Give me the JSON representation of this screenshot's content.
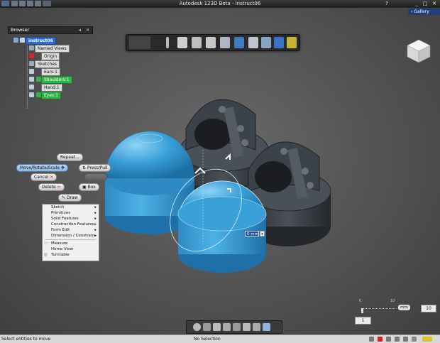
{
  "window": {
    "title": "Autodesk 123D Beta - instruct06",
    "gallery_label": "Gallery"
  },
  "browser": {
    "header": "Browser",
    "root": "instruct06",
    "items": [
      {
        "label": "Named Views",
        "style": "plain"
      },
      {
        "label": "Origin",
        "style": "plain"
      },
      {
        "label": "Sketches",
        "style": "plain"
      },
      {
        "label": "Ears:1",
        "style": "plain"
      },
      {
        "label": "Shoulders:1",
        "style": "green"
      },
      {
        "label": "Hand:1",
        "style": "plain"
      },
      {
        "label": "Eyes:1",
        "style": "green"
      }
    ]
  },
  "toolbar": {
    "icons": [
      "app-logo-icon",
      "info-icon",
      "box-icon",
      "cylinder-icon",
      "move-icon",
      "sketch-icon",
      "solid-icon",
      "shell-icon",
      "group-icon",
      "3d-text-icon",
      "material-icon"
    ]
  },
  "marking_menu": {
    "repeat": "Repeat...",
    "move": "Move/Rotate/Scale",
    "press_pull": "Press/Pull",
    "cancel": "Cancel",
    "delete": "Delete",
    "box": "Box",
    "draw": "Draw"
  },
  "context_menu": {
    "items": [
      {
        "label": "Sketch",
        "submenu": true
      },
      {
        "label": "Primitives",
        "submenu": true
      },
      {
        "label": "Solid Features",
        "submenu": true
      },
      {
        "label": "Construction Features",
        "submenu": true
      },
      {
        "label": "Form Edit",
        "submenu": true
      },
      {
        "label": "Dimension / Constrain",
        "submenu": true
      }
    ],
    "items2": [
      {
        "label": "Measure"
      },
      {
        "label": "Home View"
      },
      {
        "label": "Turntable"
      }
    ]
  },
  "dimension_input": {
    "value": "0 mm"
  },
  "grid_controls": {
    "ruler_start": "0",
    "ruler_end": "10",
    "unit": "mm",
    "grid_value": "10",
    "snap_value": "1"
  },
  "statusbar": {
    "hint": "Select entities to move",
    "selection": "No Selection"
  },
  "colors": {
    "accent_blue": "#2d6ac9",
    "selected_body": "#3aa0d8",
    "dark_body": "#3a3f46",
    "green_item": "#2fb24a"
  }
}
